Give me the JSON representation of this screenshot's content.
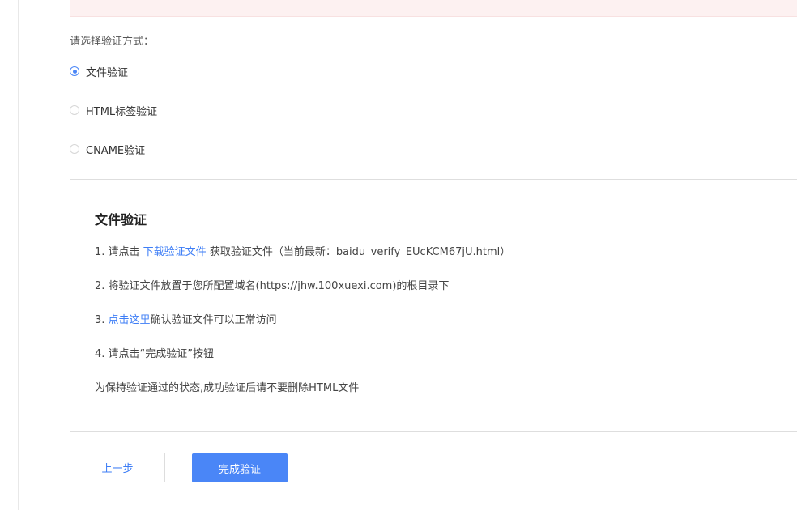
{
  "method_label": "请选择验证方式：",
  "options": [
    {
      "label": "文件验证",
      "checked": true
    },
    {
      "label": "HTML标签验证",
      "checked": false
    },
    {
      "label": "CNAME验证",
      "checked": false
    }
  ],
  "panel": {
    "title": "文件验证",
    "step1": {
      "prefix": "1.  请点击 ",
      "link": "下载验证文件",
      "suffix": " 获取验证文件（当前最新：baidu_verify_EUcKCM67jU.html）"
    },
    "step2": "2.  将验证文件放置于您所配置域名(https://jhw.100xuexi.com)的根目录下",
    "step3": {
      "prefix": "3.  ",
      "link": "点击这里",
      "suffix": "确认验证文件可以正常访问"
    },
    "step4": "4.  请点击“完成验证”按钮",
    "note": "为保持验证通过的状态,成功验证后请不要删除HTML文件"
  },
  "buttons": {
    "prev": "上一步",
    "done": "完成验证"
  },
  "colors": {
    "accent": "#4a86f7",
    "link": "#3e7ef6",
    "alert_bg": "#fdf1f1"
  }
}
